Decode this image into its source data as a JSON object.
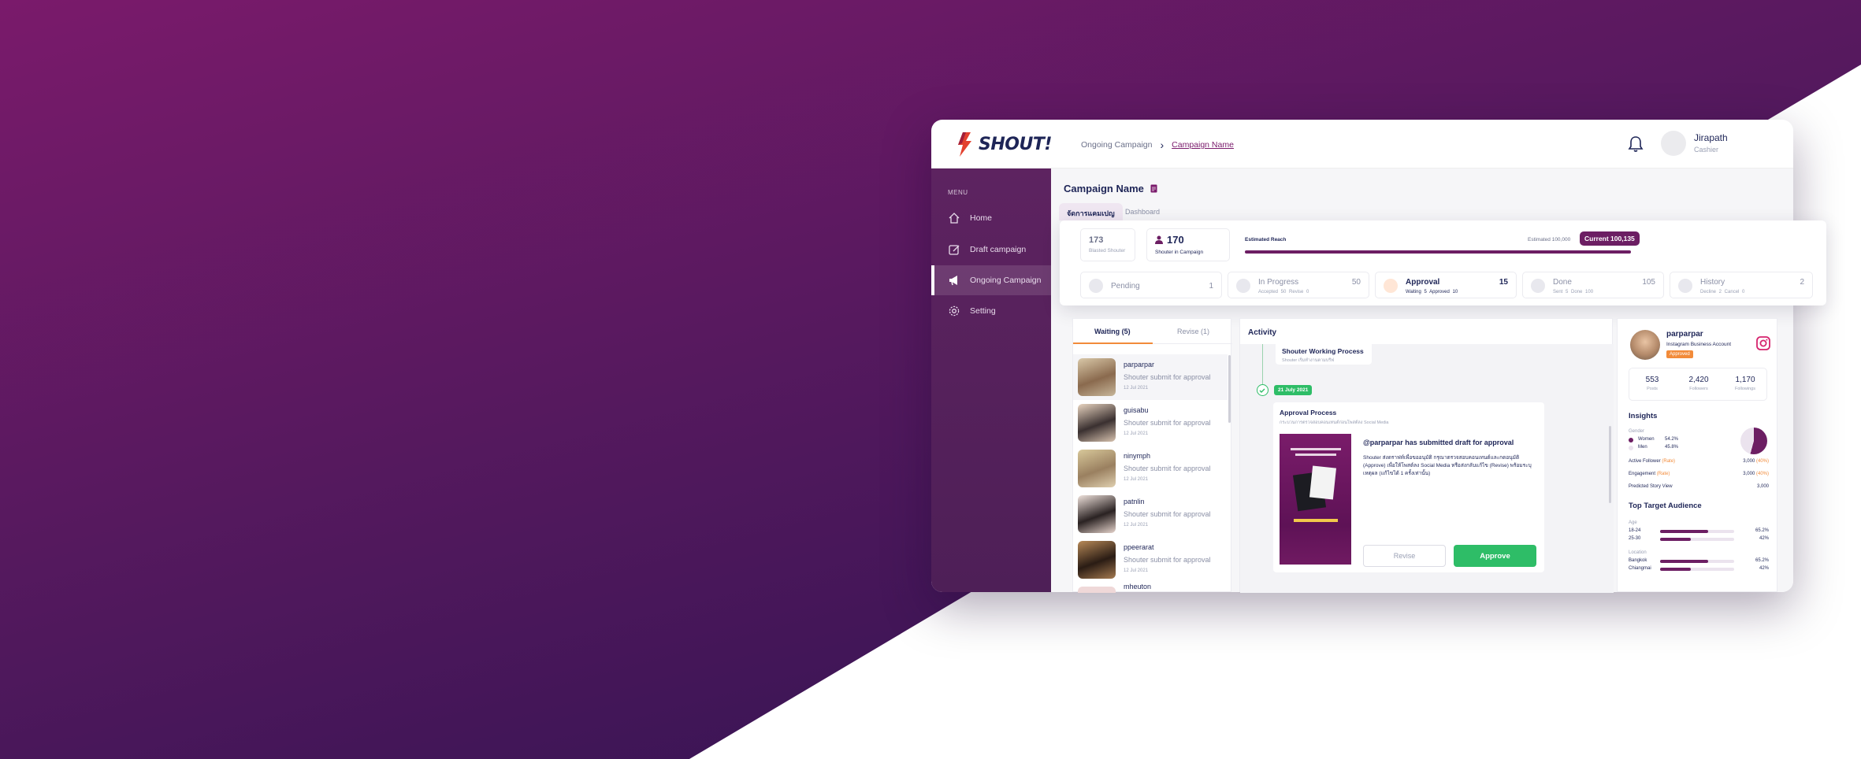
{
  "brand": {
    "name": "SHOUT!",
    "primary": "#6c1e63",
    "accent": "#f28b3a",
    "success": "#2ebd67"
  },
  "breadcrumb": {
    "parent": "Ongoing Campaign",
    "separator": "›",
    "current": "Campaign Name"
  },
  "user": {
    "name": "Jirapath",
    "role": "Cashier"
  },
  "sidebar": {
    "menu_label": "MENU",
    "items": [
      {
        "label": "Home",
        "icon": "home-icon"
      },
      {
        "label": "Draft campaign",
        "icon": "edit-icon"
      },
      {
        "label": "Ongoing Campaign",
        "icon": "megaphone-icon"
      },
      {
        "label": "Setting",
        "icon": "gear-icon"
      }
    ]
  },
  "campaign": {
    "title": "Campaign Name",
    "tabs": [
      "จัดการแคมเปญ",
      "Dashboard"
    ]
  },
  "summary": {
    "blasted": {
      "value": "173",
      "label": "Blasted Shouter"
    },
    "in_campaign": {
      "value": "170",
      "label": "Shouter in Campaign"
    },
    "reach": {
      "label": "Estimated Reach",
      "estimated": "Estimated 100,000",
      "current": "Current 100,135",
      "progress": 1.0
    }
  },
  "stages": [
    {
      "name": "Pending",
      "count": "1",
      "sub": ""
    },
    {
      "name": "In Progress",
      "count": "50",
      "sub": "Accepted 50  Revise 0"
    },
    {
      "name": "Approval",
      "count": "15",
      "sub": "Waiting 5  Approved 10"
    },
    {
      "name": "Done",
      "count": "105",
      "sub": "Sent 5  Done 100"
    },
    {
      "name": "History",
      "count": "2",
      "sub": "Decline 2  Cancel 0"
    }
  ],
  "queue": {
    "tabs": [
      "Waiting (5)",
      "Revise (1)"
    ],
    "items": [
      {
        "name": "parparpar",
        "status": "Shouter submit for approval",
        "date": "12 Jul 2021"
      },
      {
        "name": "guisabu",
        "status": "Shouter submit for approval",
        "date": "12 Jul 2021"
      },
      {
        "name": "ninymph",
        "status": "Shouter submit for approval",
        "date": "12 Jul 2021"
      },
      {
        "name": "patnlin",
        "status": "Shouter submit for approval",
        "date": "12 Jul 2021"
      },
      {
        "name": "ppeerarat",
        "status": "Shouter submit for approval",
        "date": "12 Jul 2021"
      },
      {
        "name": "mheuton",
        "status": "",
        "date": ""
      }
    ]
  },
  "activity": {
    "title": "Activity",
    "working": {
      "title": "Shouter Working Process",
      "sub": "Shouter เริ่มทำงานตามบรีฟ"
    },
    "date": "21 July 2021",
    "approval": {
      "title": "Approval Process",
      "sub": "กระบวนการตรวจสอบคอนเทนต์ก่อนโพสต์ลง Social Media",
      "message": "@parparpar has submitted draft for approval",
      "description": "Shouter ส่งดราฟท์เพื่อขออนุมัติ กรุณาตรวจสอบคอนเทนต์และกดอนุมัติ (Approve) เพื่อให้โพสต์ลง Social Media หรือส่งกลับแก้ไข (Revise) พร้อมระบุเหตุผล (แก้ไขได้ 1 ครั้งเท่านั้น)",
      "revise_label": "Revise",
      "approve_label": "Approve"
    }
  },
  "profile": {
    "name": "parparpar",
    "type": "Instagram Business Account",
    "badge": "Approved",
    "stats": [
      {
        "value": "553",
        "label": "Posts"
      },
      {
        "value": "2,420",
        "label": "Followers"
      },
      {
        "value": "1,170",
        "label": "Followings"
      }
    ],
    "insights_title": "Insights",
    "gender_label": "Gender",
    "gender": [
      {
        "label": "Women",
        "value": "54.2%",
        "share": 0.542,
        "color": "#6c1e63"
      },
      {
        "label": "Men",
        "value": "45.8%",
        "share": 0.458,
        "color": "#ebe3ee"
      }
    ],
    "metrics": [
      {
        "label": "Active Follower",
        "note": "(Rate)",
        "value": "3,000",
        "pct": "(40%)"
      },
      {
        "label": "Engagement",
        "note": "(Rate)",
        "value": "3,000",
        "pct": "(40%)"
      },
      {
        "label": "Predicted Story View",
        "note": "",
        "value": "3,000",
        "pct": ""
      }
    ],
    "audience_title": "Top Target Audience",
    "age_label": "Age",
    "age": [
      {
        "label": "18-24",
        "value": "65.2%",
        "share": 0.652
      },
      {
        "label": "25-30",
        "value": "42%",
        "share": 0.42
      }
    ],
    "location_label": "Location",
    "location": [
      {
        "label": "Bangkok",
        "value": "65.2%",
        "share": 0.652
      },
      {
        "label": "Chiangmai",
        "value": "42%",
        "share": 0.42
      }
    ]
  }
}
